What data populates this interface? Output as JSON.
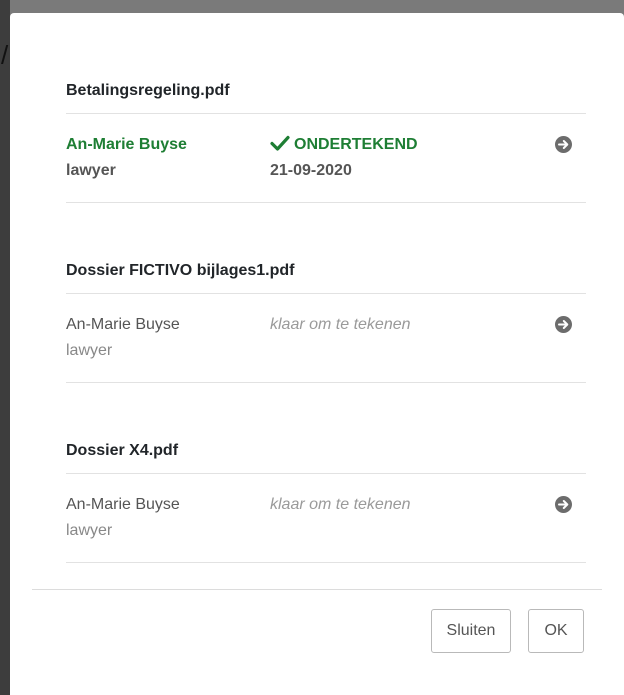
{
  "documents": [
    {
      "title": "Betalingsregeling.pdf",
      "signer_name": "An-Marie Buyse",
      "signer_role": "lawyer",
      "status": "ONDERTEKEND",
      "date": "21-09-2020",
      "state": "signed"
    },
    {
      "title": "Dossier FICTIVO bijlages1.pdf",
      "signer_name": "An-Marie Buyse",
      "signer_role": "lawyer",
      "status": "klaar om te tekenen",
      "state": "pending"
    },
    {
      "title": "Dossier X4.pdf",
      "signer_name": "An-Marie Buyse",
      "signer_role": "lawyer",
      "status": "klaar om te tekenen",
      "state": "pending"
    }
  ],
  "footer": {
    "close_label": "Sluiten",
    "ok_label": "OK"
  },
  "icons": {
    "signed": "check-icon",
    "open": "arrow-circle-right-icon"
  },
  "colors": {
    "signed": "#1e7e34",
    "pending_status": "#9a9a9a",
    "arrow_icon": "#6c6c6c"
  }
}
